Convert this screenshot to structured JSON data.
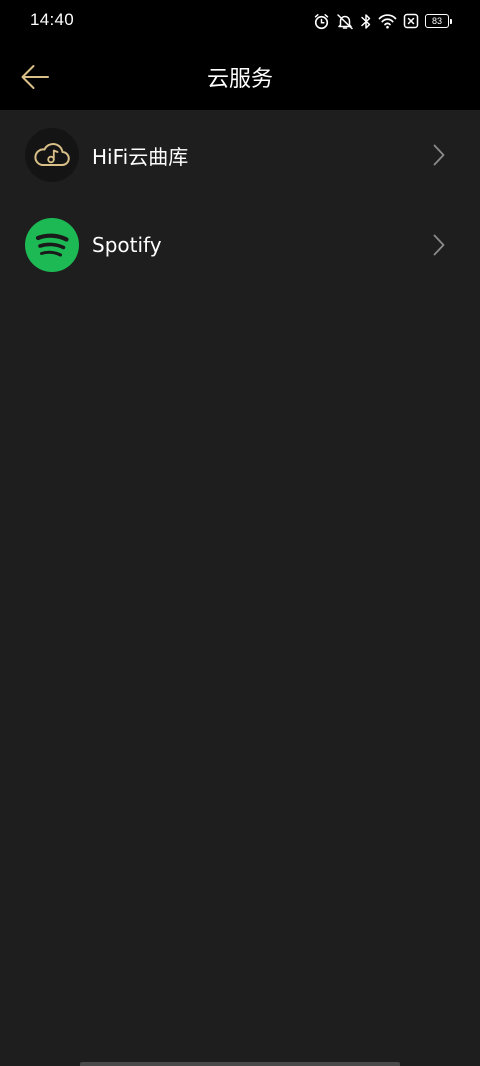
{
  "status_bar": {
    "time": "14:40",
    "battery_level": "83",
    "icons": [
      "alarm-icon",
      "mute-icon",
      "bluetooth-icon",
      "wifi-icon",
      "sim-disabled-icon",
      "battery-icon"
    ]
  },
  "app_bar": {
    "title": "云服务",
    "back_icon": "back-arrow-icon"
  },
  "services": [
    {
      "label": "HiFi云曲库",
      "icon": "hifi-cloud-music-icon"
    },
    {
      "label": "Spotify",
      "icon": "spotify-icon"
    }
  ],
  "colors": {
    "background": "#1e1e1e",
    "bar_background": "#000000",
    "accent_gold": "#d9c089",
    "spotify_green": "#1db954",
    "chevron": "#8a8a8a"
  }
}
